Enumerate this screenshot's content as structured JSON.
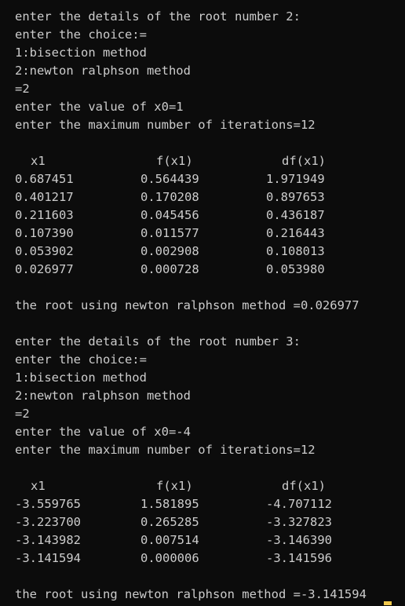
{
  "block1": {
    "l1": "enter the details of the root number 2:",
    "l2": "enter the choice:=",
    "l3": "1:bisection method",
    "l4": "2:newton ralphson method",
    "l5": "=2",
    "l6": "enter the value of x0=1",
    "l7": "enter the maximum number of iterations=12",
    "headers": [
      "x1",
      "f(x1)",
      "df(x1)"
    ],
    "rows": [
      [
        "0.687451",
        "0.564439",
        "1.971949"
      ],
      [
        "0.401217",
        "0.170208",
        "0.897653"
      ],
      [
        "0.211603",
        "0.045456",
        "0.436187"
      ],
      [
        "0.107390",
        "0.011577",
        "0.216443"
      ],
      [
        "0.053902",
        "0.002908",
        "0.108013"
      ],
      [
        "0.026977",
        "0.000728",
        "0.053980"
      ]
    ],
    "result": "the root using newton ralphson method =0.026977"
  },
  "block2": {
    "l1": "enter the details of the root number 3:",
    "l2": "enter the choice:=",
    "l3": "1:bisection method",
    "l4": "2:newton ralphson method",
    "l5": "=2",
    "l6": "enter the value of x0=-4",
    "l7": "enter the maximum number of iterations=12",
    "headers": [
      "x1",
      "f(x1)",
      "df(x1)"
    ],
    "rows": [
      [
        "-3.559765",
        "1.581895",
        "-4.707112"
      ],
      [
        "-3.223700",
        "0.265285",
        "-3.327823"
      ],
      [
        "-3.143982",
        "0.007514",
        "-3.146390"
      ],
      [
        "-3.141594",
        "0.000006",
        "-3.141596"
      ]
    ],
    "result": "the root using newton ralphson method =-3.141594"
  },
  "colors": {
    "background": "#0c0c0c",
    "text": "#cccccc",
    "cursor": "#f2c94c"
  }
}
